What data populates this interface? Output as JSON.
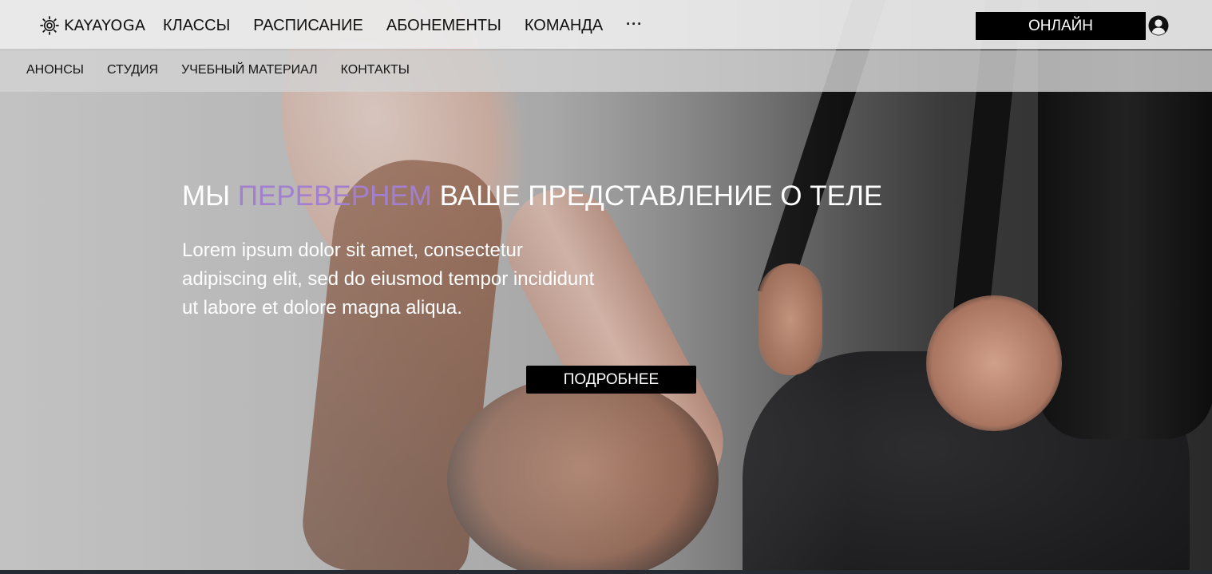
{
  "header": {
    "logo_text": "KAYAYOGA",
    "nav": [
      {
        "label": "КЛАССЫ"
      },
      {
        "label": "РАСПИСАНИЕ"
      },
      {
        "label": "АБОНЕМЕНТЫ"
      },
      {
        "label": "КОМАНДА"
      }
    ],
    "more_label": "···",
    "online_button": "ОНЛАЙН",
    "user_icon": "user-circle-icon"
  },
  "subnav": [
    {
      "label": "АНОНСЫ"
    },
    {
      "label": "СТУДИЯ"
    },
    {
      "label": "УЧЕБНЫЙ МАТЕРИАЛ"
    },
    {
      "label": "КОНТАКТЫ"
    }
  ],
  "hero": {
    "title_part1": "МЫ",
    "title_accent": "ПЕРЕВЕРНЕМ",
    "title_part2": "ВАШЕ ПРЕДСТАВЛЕНИЕ О ТЕЛЕ",
    "text": "Lorem ipsum dolor sit amet, consectetur adipiscing elit, sed do eiusmod tempor incididunt ut labore et dolore magna aliqua.",
    "button": "ПОДРОБНЕЕ"
  },
  "colors": {
    "accent": "#a37fd0",
    "button_bg": "#000000",
    "button_text": "#ffffff"
  }
}
